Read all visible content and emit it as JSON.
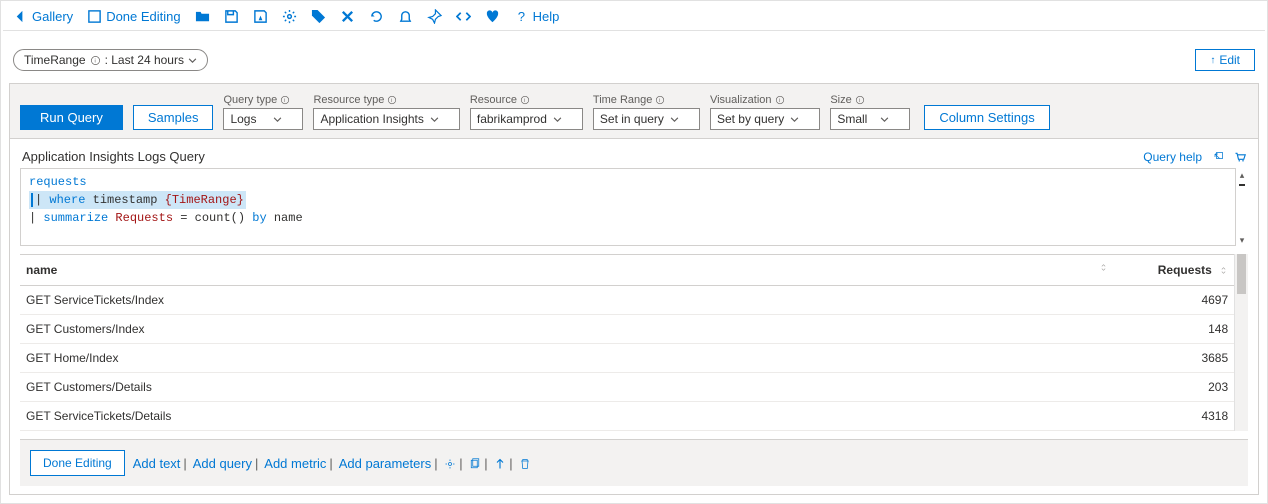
{
  "toolbar": {
    "gallery": "Gallery",
    "done_editing": "Done Editing",
    "help": "Help"
  },
  "params": {
    "time_range_label": "TimeRange",
    "time_range_value": ": Last 24 hours",
    "edit_label": "Edit"
  },
  "query_controls": {
    "run": "Run Query",
    "samples": "Samples",
    "query_type": {
      "label": "Query type",
      "value": "Logs"
    },
    "resource_type": {
      "label": "Resource type",
      "value": "Application Insights"
    },
    "resource": {
      "label": "Resource",
      "value": "fabrikamprod"
    },
    "time_range": {
      "label": "Time Range",
      "value": "Set in query"
    },
    "visualization": {
      "label": "Visualization",
      "value": "Set by query"
    },
    "size": {
      "label": "Size",
      "value": "Small"
    },
    "column_settings": "Column Settings"
  },
  "query": {
    "label": "Application Insights Logs Query",
    "help_label": "Query help",
    "line1_table": "requests",
    "line2_pipe": "|",
    "line2_where": "where",
    "line2_col": "timestamp",
    "line2_param": "{TimeRange}",
    "line3_pipe": "|",
    "line3_summ": "summarize",
    "line3_agg": "Requests",
    "line3_eq": "= count()",
    "line3_by": "by",
    "line3_name": "name"
  },
  "table": {
    "columns": {
      "name": "name",
      "requests": "Requests"
    },
    "rows": [
      {
        "name": "GET ServiceTickets/Index",
        "requests": "4697"
      },
      {
        "name": "GET Customers/Index",
        "requests": "148"
      },
      {
        "name": "GET Home/Index",
        "requests": "3685"
      },
      {
        "name": "GET Customers/Details",
        "requests": "203"
      },
      {
        "name": "GET ServiceTickets/Details",
        "requests": "4318"
      }
    ]
  },
  "footer": {
    "done": "Done Editing",
    "add_text": "Add text",
    "add_query": "Add query",
    "add_metric": "Add metric",
    "add_parameters": "Add parameters"
  }
}
